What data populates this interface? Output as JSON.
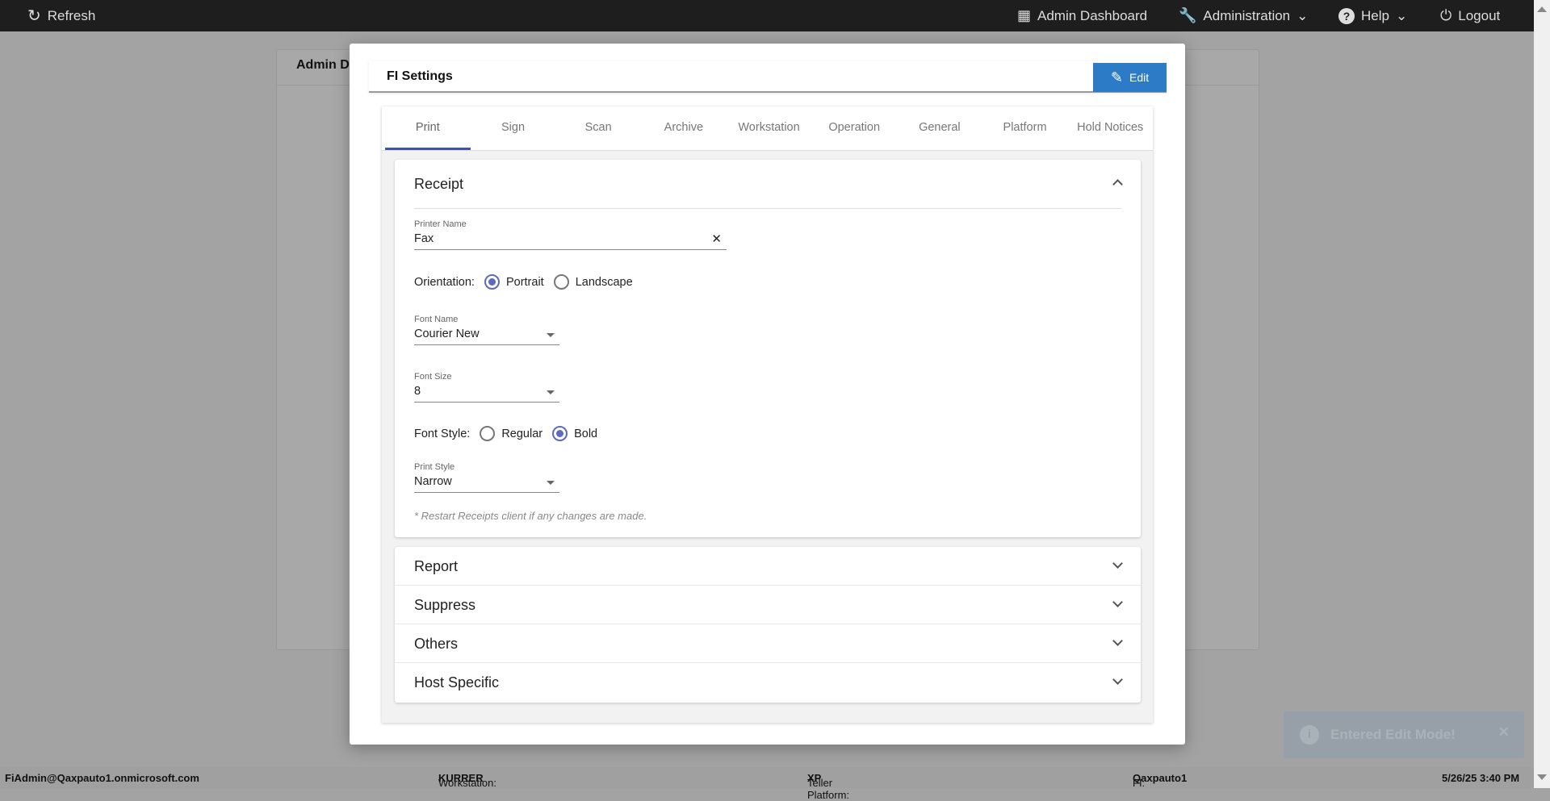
{
  "topbar": {
    "refresh": "Refresh",
    "admin_dashboard": "Admin Dashboard",
    "administration": "Administration",
    "help": "Help",
    "logout": "Logout"
  },
  "background": {
    "card_title": "Admin D"
  },
  "modal": {
    "title": "FI Settings",
    "edit_label": "Edit",
    "tabs": [
      "Print",
      "Sign",
      "Scan",
      "Archive",
      "Workstation",
      "Operation",
      "General",
      "Platform",
      "Hold Notices"
    ],
    "active_tab": "Print",
    "receipt": {
      "title": "Receipt",
      "printer_name_label": "Printer Name",
      "printer_name_value": "Fax",
      "orientation_label": "Orientation:",
      "orientation_options": [
        "Portrait",
        "Landscape"
      ],
      "orientation_selected": "Portrait",
      "font_name_label": "Font Name",
      "font_name_value": "Courier New",
      "font_size_label": "Font Size",
      "font_size_value": "8",
      "font_style_label": "Font Style:",
      "font_style_options": [
        "Regular",
        "Bold"
      ],
      "font_style_selected": "Bold",
      "print_style_label": "Print Style",
      "print_style_value": "Narrow",
      "note": "* Restart Receipts client if any changes are made."
    },
    "sections": [
      "Report",
      "Suppress",
      "Others",
      "Host Specific"
    ]
  },
  "status": {
    "user": "FiAdmin@Qaxpauto1.onmicrosoft.com",
    "workstation_label": "Workstation:",
    "workstation": "KURRER",
    "platform_label": "Teller Platform:",
    "platform": "XP",
    "fi_label": "FI:",
    "fi": "Qaxpauto1",
    "datetime": "5/26/25 3:40 PM"
  },
  "toast": {
    "message": "Entered Edit Mode!"
  },
  "colors": {
    "accent": "#3f51b5",
    "edit_button": "#2c7bc6",
    "topbar": "#1e1e1e"
  }
}
